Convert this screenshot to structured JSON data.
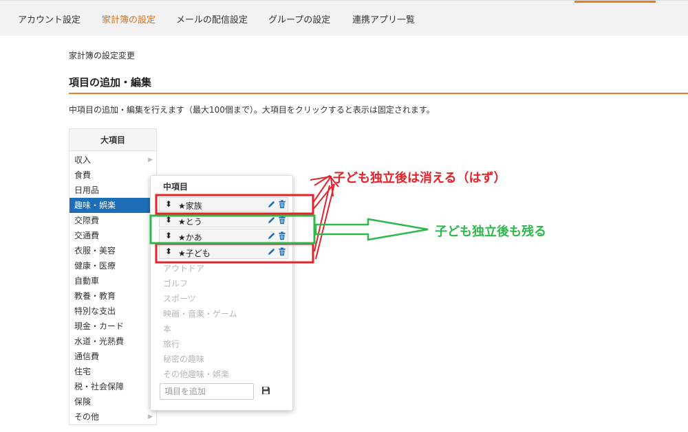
{
  "topnav": {
    "tabs": [
      "アカウント設定",
      "家計簿の設定",
      "メールの配信設定",
      "グループの設定",
      "連携アプリ一覧"
    ],
    "active_tab": "家計簿の設定",
    "accent_color": "#e67e22"
  },
  "breadcrumb": "家計簿の設定変更",
  "section": {
    "title": "項目の追加・編集",
    "description": "中項目の追加・編集を行えます（最大100個まで）。大項目をクリックすると表示は固定されます。"
  },
  "major": {
    "header": "大項目",
    "items": [
      "収入",
      "食費",
      "日用品",
      "趣味・娯楽",
      "交際費",
      "交通費",
      "衣服・美容",
      "健康・医療",
      "自動車",
      "教養・教育",
      "特別な支出",
      "現金・カード",
      "水道・光熱費",
      "通信費",
      "住宅",
      "税・社会保障",
      "保険",
      "その他"
    ],
    "selected": "趣味・娯楽",
    "selected_color": "#1d6db7"
  },
  "sub": {
    "header": "中項目",
    "custom_items": [
      "★家族",
      "★とう",
      "★かあ",
      "★子ども"
    ],
    "preset_items": [
      "アウトドア",
      "ゴルフ",
      "スポーツ",
      "映画・音楽・ゲーム",
      "本",
      "旅行",
      "秘密の趣味",
      "その他趣味・娯楽"
    ],
    "add_placeholder": "項目を追加",
    "icon_color": "#1d6db7",
    "icons": {
      "grip": "sort-arrows-icon",
      "edit": "pencil-icon",
      "delete": "trash-icon",
      "save": "floppy-disk-icon"
    }
  },
  "annotations": {
    "red_text": "子ども独立後は消える（はず）",
    "green_text": "子ども独立後も残る",
    "red_color": "#e8202a",
    "green_color": "#2eb84a"
  }
}
